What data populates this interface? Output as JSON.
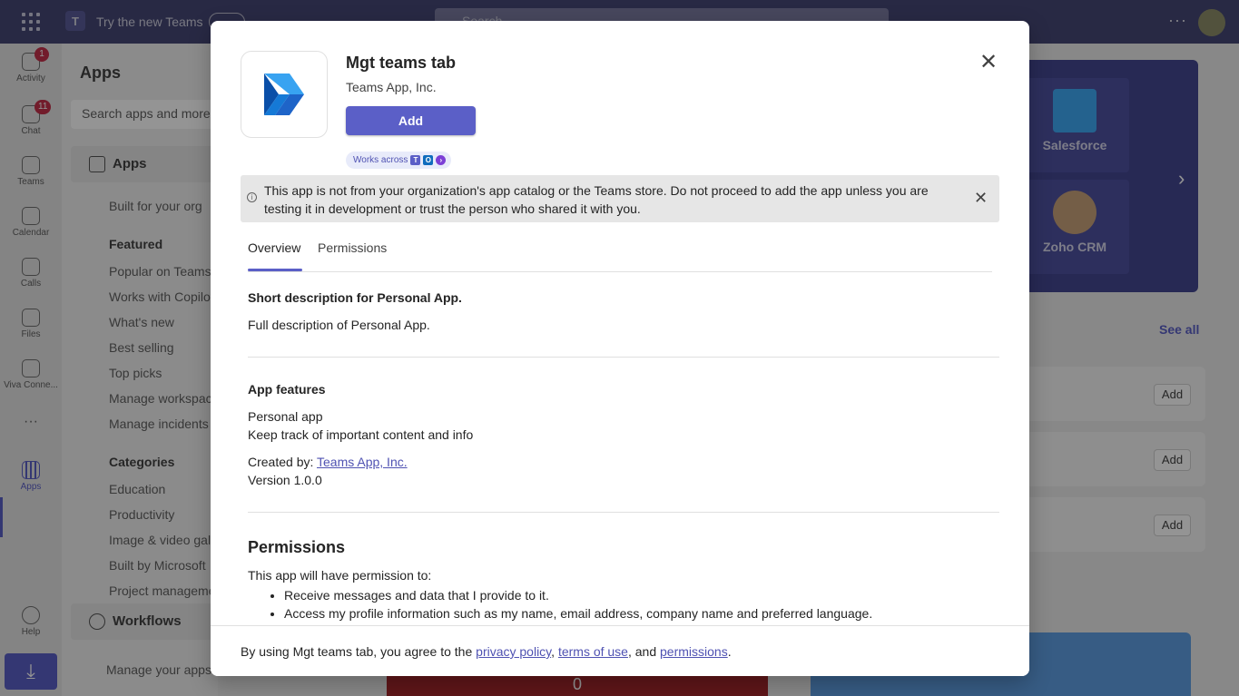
{
  "topbar": {
    "try_new_label": "Try the new Teams",
    "search_placeholder": "Search",
    "more_label": "···"
  },
  "rail": {
    "items": [
      {
        "label": "Activity",
        "badge": "1"
      },
      {
        "label": "Chat",
        "badge": "11"
      },
      {
        "label": "Teams",
        "badge": ""
      },
      {
        "label": "Calendar",
        "badge": ""
      },
      {
        "label": "Calls",
        "badge": ""
      },
      {
        "label": "Files",
        "badge": ""
      },
      {
        "label": "Viva Conne...",
        "badge": ""
      },
      {
        "label": "···",
        "badge": ""
      },
      {
        "label": "Apps",
        "badge": ""
      },
      {
        "label": "Help",
        "badge": ""
      }
    ]
  },
  "apps_sidebar": {
    "title": "Apps",
    "search_placeholder": "Search apps and more",
    "apps_section": "Apps",
    "built_for_org": "Built for your org",
    "featured_heading": "Featured",
    "featured_items": [
      "Popular on Teams",
      "Works with Copilot",
      "What's new",
      "Best selling",
      "Top picks",
      "Manage workspaces",
      "Manage incidents"
    ],
    "categories_heading": "Categories",
    "category_items": [
      "Education",
      "Productivity",
      "Image & video galleries",
      "Built by Microsoft",
      "Project management"
    ],
    "workflows_section": "Workflows",
    "manage_apps": "Manage your apps"
  },
  "background": {
    "hero_cards": [
      {
        "label": "Salesforce",
        "color": "#3fa9f5"
      },
      {
        "label": "Zoho CRM",
        "color": "#c9a37a"
      }
    ],
    "see_all": "See all",
    "add_label": "Add",
    "bottom_number": "0"
  },
  "dialog": {
    "app_name": "Mgt teams tab",
    "publisher": "Teams App, Inc.",
    "add_button": "Add",
    "works_across": "Works across",
    "warning": "This app is not from your organization's app catalog or the Teams store. Do not proceed to add the app unless you are testing it in development or trust the person who shared it with you.",
    "tabs": [
      "Overview",
      "Permissions"
    ],
    "short_description": "Short description for Personal App.",
    "full_description": "Full description of Personal App.",
    "features_heading": "App features",
    "feature_name": "Personal app",
    "feature_description": "Keep track of important content and info",
    "created_by_label": "Created by:",
    "created_by_link": "Teams App, Inc.",
    "version": "Version 1.0.0",
    "permissions_heading": "Permissions",
    "permissions_intro": "This app will have permission to:",
    "permissions": [
      "Receive messages and data that I provide to it.",
      "Access my profile information such as my name, email address, company name and preferred language."
    ],
    "footer": {
      "prefix": "By using Mgt teams tab, you agree to the",
      "privacy": "privacy policy",
      "comma": ",",
      "terms": "terms of use",
      "and": ", and",
      "permissions": "permissions",
      "period": "."
    }
  },
  "colors": {
    "accent": "#5b5fc7",
    "topbar": "#464775"
  }
}
